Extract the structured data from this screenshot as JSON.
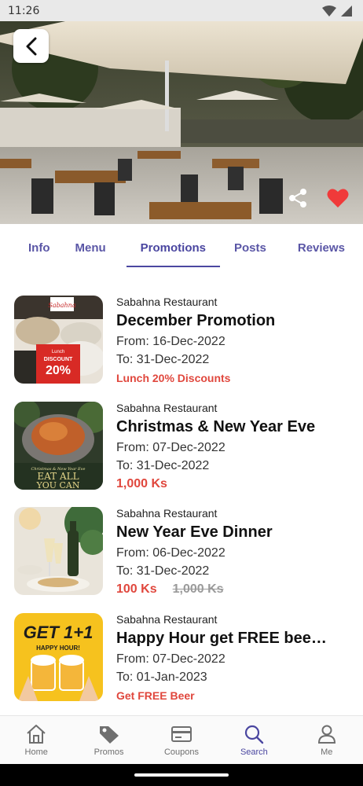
{
  "status_bar": {
    "time": "11:26"
  },
  "hero": {
    "image": "restaurant-terrace-photo"
  },
  "tabs": [
    {
      "label": "Info"
    },
    {
      "label": "Menu"
    },
    {
      "label": "Promotions"
    },
    {
      "label": "Posts"
    },
    {
      "label": "Reviews"
    }
  ],
  "active_tab": "Promotions",
  "promotions": [
    {
      "merchant": "Sabahna Restaurant",
      "title": "December Promotion",
      "from": "From: 16-Dec-2022",
      "to": "To: 31-Dec-2022",
      "note": "Lunch 20% Discounts",
      "thumb_label": "Lunch",
      "thumb_label2": "DISCOUNT",
      "thumb_percent": "20%",
      "thumb_brand": "Sabahna"
    },
    {
      "merchant": "Sabahna Restaurant",
      "title": "Christmas & New Year Eve",
      "from": "From: 07-Dec-2022",
      "to": "To: 31-Dec-2022",
      "price": "1,000 Ks",
      "thumb_small": "Christmas & New Year Eve",
      "thumb_big1": "EAT ALL",
      "thumb_big2": "YOU CAN"
    },
    {
      "merchant": "Sabahna Restaurant",
      "title": "New Year Eve Dinner",
      "from": "From: 06-Dec-2022",
      "to": "To: 31-Dec-2022",
      "price": "100 Ks",
      "old_price": "1,000 Ks"
    },
    {
      "merchant": "Sabahna Restaurant",
      "title": "Happy Hour get FREE beer with every beer",
      "from": "From: 07-Dec-2022",
      "to": "To: 01-Jan-2023",
      "note": "Get FREE Beer",
      "thumb_big": "GET 1+1",
      "thumb_small": "HAPPY HOUR!"
    }
  ],
  "bottom_nav": [
    {
      "label": "Home",
      "icon": "home-icon"
    },
    {
      "label": "Promos",
      "icon": "tag-icon"
    },
    {
      "label": "Coupons",
      "icon": "card-icon"
    },
    {
      "label": "Search",
      "icon": "search-icon"
    },
    {
      "label": "Me",
      "icon": "person-icon"
    }
  ],
  "colors": {
    "accent": "#4a46a0",
    "price_red": "#e0473d",
    "heart_red": "#f03a3a"
  }
}
